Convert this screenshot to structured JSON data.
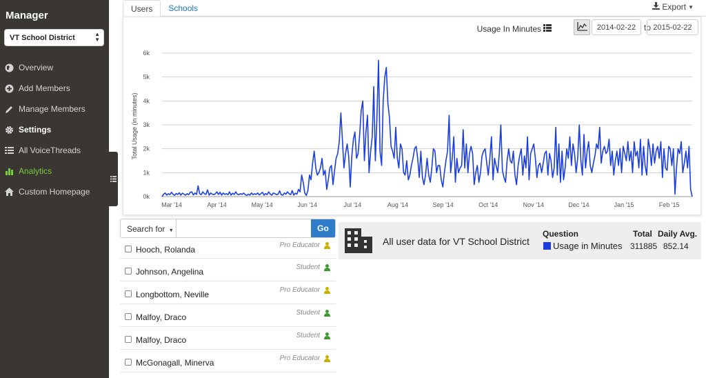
{
  "sidebar": {
    "title": "Manager",
    "selected_org": "VT School District",
    "items": [
      {
        "label": "Overview",
        "icon": "globe-icon"
      },
      {
        "label": "Add Members",
        "icon": "plus-circle-icon"
      },
      {
        "label": "Manage Members",
        "icon": "pencil-icon"
      },
      {
        "label": "Settings",
        "icon": "gear-icon"
      },
      {
        "label": "All VoiceThreads",
        "icon": "list-icon"
      },
      {
        "label": "Analytics",
        "icon": "bar-chart-icon"
      },
      {
        "label": "Custom Homepage",
        "icon": "home-icon"
      }
    ],
    "active_item": "Settings",
    "highlight_item": "Analytics"
  },
  "tabs": [
    {
      "label": "Users"
    },
    {
      "label": "Schools"
    }
  ],
  "export_label": "Export",
  "controls": {
    "metric_label": "Usage In Minutes",
    "date_from": "2014-02-22",
    "to_label": "to",
    "date_to": "2015-02-22"
  },
  "chart_data": {
    "type": "line",
    "ylabel": "Total Usage (in minutes)",
    "ylim": [
      0,
      6000
    ],
    "y_ticks": [
      "0k",
      "1k",
      "2k",
      "3k",
      "4k",
      "5k",
      "6k"
    ],
    "x_ticks": [
      "Mar '14",
      "Apr '14",
      "May '14",
      "Jun '14",
      "Jul '14",
      "Aug '14",
      "Sep '14",
      "Oct '14",
      "Nov '14",
      "Dec '14",
      "Jan '15",
      "Feb '15"
    ],
    "grid": true,
    "color": "#1a3ee0",
    "series": [
      {
        "values": [
          0,
          100,
          150,
          60,
          120,
          80,
          180,
          100,
          50,
          130,
          90,
          160,
          60,
          140,
          100,
          60,
          120,
          80,
          180,
          200,
          70,
          150,
          90,
          450,
          120,
          80,
          200,
          120,
          90,
          280,
          60,
          150,
          100,
          80,
          120,
          200,
          90,
          180,
          60,
          150,
          90,
          120,
          80,
          200,
          60,
          140,
          90,
          200,
          100,
          80,
          120,
          90,
          150,
          80,
          50,
          100,
          60,
          150,
          80,
          120,
          90,
          150,
          70,
          120,
          180,
          60,
          130,
          80,
          200,
          100,
          60,
          150,
          120,
          80,
          100,
          240,
          80,
          60,
          150,
          100,
          200,
          120,
          80,
          250,
          60,
          140,
          100,
          300,
          200,
          900,
          600,
          150,
          50,
          250,
          900,
          700,
          1400,
          1900,
          1200,
          900,
          1000,
          1200,
          1600,
          900,
          1100,
          300,
          700,
          1200,
          1300,
          500,
          1100,
          1600,
          1800,
          2300,
          3500,
          2400,
          1200,
          1800,
          2200,
          1700,
          400,
          1700,
          2400,
          2700,
          1600,
          1800,
          2600,
          3600,
          4000,
          1500,
          2700,
          3400,
          1000,
          1900,
          2500,
          4600,
          1500,
          3300,
          5700,
          1900,
          1300,
          4000,
          5000,
          5400,
          3900,
          3300,
          2100,
          1900,
          1600,
          2900,
          1600,
          1200,
          2200,
          2000,
          1000,
          900,
          1500,
          700,
          900,
          1300,
          1600,
          2000,
          2100,
          1600,
          800,
          1900,
          800,
          500,
          900,
          1600,
          900,
          600,
          1200,
          2000,
          1900,
          1000,
          1300,
          1300,
          700,
          400,
          1000,
          1500,
          1900,
          3400,
          1000,
          1600,
          2500,
          600,
          1600,
          1000,
          1200,
          1300,
          2800,
          1200,
          2200,
          1000,
          1800,
          2100,
          1800,
          500,
          1000,
          1300,
          600,
          1000,
          1700,
          1900,
          2000,
          1400,
          900,
          1600,
          2500,
          700,
          1600,
          1300,
          1000,
          1800,
          3000,
          1100,
          800,
          600,
          1500,
          2000,
          1500,
          1400,
          1900,
          900,
          500,
          1300,
          1700,
          2000,
          900,
          1700,
          1200,
          2500,
          700,
          1800,
          2000,
          2200,
          1600,
          800,
          1300,
          1400,
          1000,
          1400,
          1800,
          1900,
          900,
          1800,
          1500,
          800,
          1200,
          2900,
          900,
          2200,
          600,
          1900,
          700,
          1200,
          2000,
          1600,
          2500,
          1300,
          2200,
          1800,
          1000,
          1600,
          3000,
          1500,
          900,
          2600,
          1200,
          1900,
          2300,
          1300,
          1000,
          1400,
          1700,
          2200,
          2000,
          2900,
          1400,
          1900,
          2100,
          1800,
          1900,
          2400,
          1300,
          1900,
          900,
          1500,
          1900,
          1300,
          2000,
          1000,
          2100,
          1800,
          1500,
          2300,
          1500,
          1900,
          1000,
          2300,
          1700,
          1900,
          1200,
          2400,
          900,
          2100,
          1300,
          900,
          2400,
          2000,
          1300,
          2200,
          1400,
          1900,
          2100,
          1600,
          2300,
          800,
          2000,
          1200,
          1100,
          2100,
          2000,
          1300,
          2000,
          100,
          1200,
          2000,
          1800,
          2300,
          1000,
          1400,
          1900,
          1200,
          2100,
          300,
          0
        ]
      }
    ]
  },
  "search": {
    "label": "Search for",
    "go": "Go"
  },
  "users": [
    {
      "name": "Hooch, Rolanda",
      "role": "Pro Educator",
      "role_color": "#c5b200"
    },
    {
      "name": "Johnson, Angelina",
      "role": "Student",
      "role_color": "#3e9a2e"
    },
    {
      "name": "Longbottom, Neville",
      "role": "Pro Educator",
      "role_color": "#c5b200"
    },
    {
      "name": "Malfoy, Draco",
      "role": "Student",
      "role_color": "#3e9a2e"
    },
    {
      "name": "Malfoy, Draco",
      "role": "Student",
      "role_color": "#3e9a2e"
    },
    {
      "name": "McGonagall, Minerva",
      "role": "Pro Educator",
      "role_color": "#c5b200"
    }
  ],
  "summary": {
    "description": "All user data for VT School District",
    "question_header": "Question",
    "question_value": "Usage in Minutes",
    "question_color": "#1a3ee0",
    "total_header": "Total",
    "total_value": "311885",
    "daily_header": "Daily Avg.",
    "daily_value": "852.14"
  }
}
